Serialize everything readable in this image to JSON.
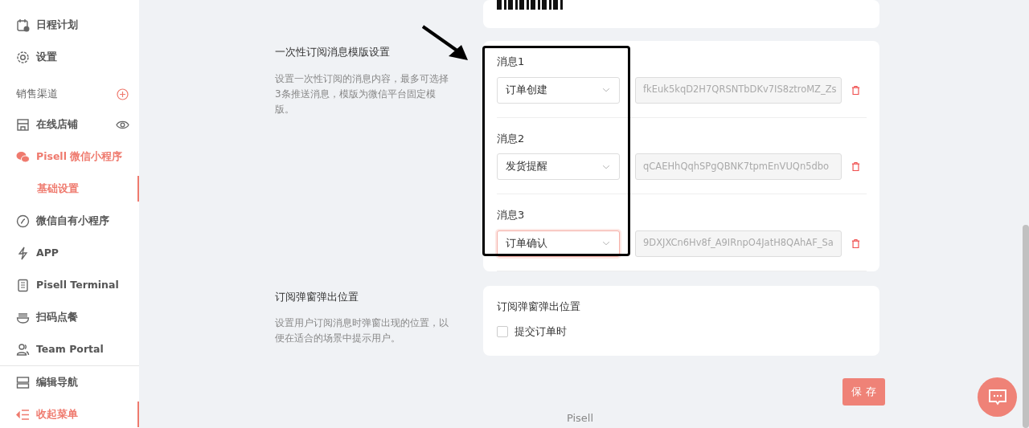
{
  "sidebar": {
    "items": [
      {
        "kind": "item",
        "label": "日程计划",
        "selected": false
      },
      {
        "kind": "item",
        "label": "设置",
        "selected": false
      },
      {
        "kind": "section",
        "label": "销售渠道"
      },
      {
        "kind": "item",
        "label": "在线店铺",
        "selected": false
      },
      {
        "kind": "item",
        "label": "Pisell 微信小程序",
        "selected": true,
        "expanded": true,
        "children": [
          {
            "label": "基础设置",
            "selected": true
          }
        ]
      },
      {
        "kind": "item",
        "label": "微信自有小程序",
        "selected": false
      },
      {
        "kind": "item",
        "label": "APP",
        "selected": false
      },
      {
        "kind": "item",
        "label": "Pisell Terminal",
        "selected": false
      },
      {
        "kind": "item",
        "label": "扫码点餐",
        "selected": false
      },
      {
        "kind": "item",
        "label": "Team Portal",
        "selected": false
      }
    ],
    "footer_items": [
      {
        "label": "编辑导航",
        "selected": false
      },
      {
        "label": "收起菜单",
        "selected": true
      }
    ]
  },
  "sections": [
    {
      "title": "一次性订阅消息模版设置",
      "description": "设置一次性订阅的消息内容，最多可选择3条推送消息，模版为微信平台固定模版。",
      "messages": [
        {
          "label": "消息1",
          "value": "订单创建",
          "template_id": "fkEuk5kqD2H7QRSNTbDKv7IS8ztroMZ_Zs",
          "focused": false
        },
        {
          "label": "消息2",
          "value": "发货提醒",
          "template_id": "qCAEHhQqhSPgQBNK7tpmEnVUQn5dbo",
          "focused": false
        },
        {
          "label": "消息3",
          "value": "订单确认",
          "template_id": "9DXJXCn6Hv8f_A9IRnpO4JatH8QAhAF_Sa",
          "focused": true
        }
      ]
    },
    {
      "title": "订阅弹窗弹出位置",
      "description": "设置用户订阅消息时弹窗出现的位置，以便在适合的场景中提示用户。",
      "heading": "订阅弹窗弹出位置",
      "checkboxes": [
        {
          "label": "提交订单时",
          "checked": false
        }
      ]
    }
  ],
  "save_button": "保 存",
  "footer": "Pisell"
}
